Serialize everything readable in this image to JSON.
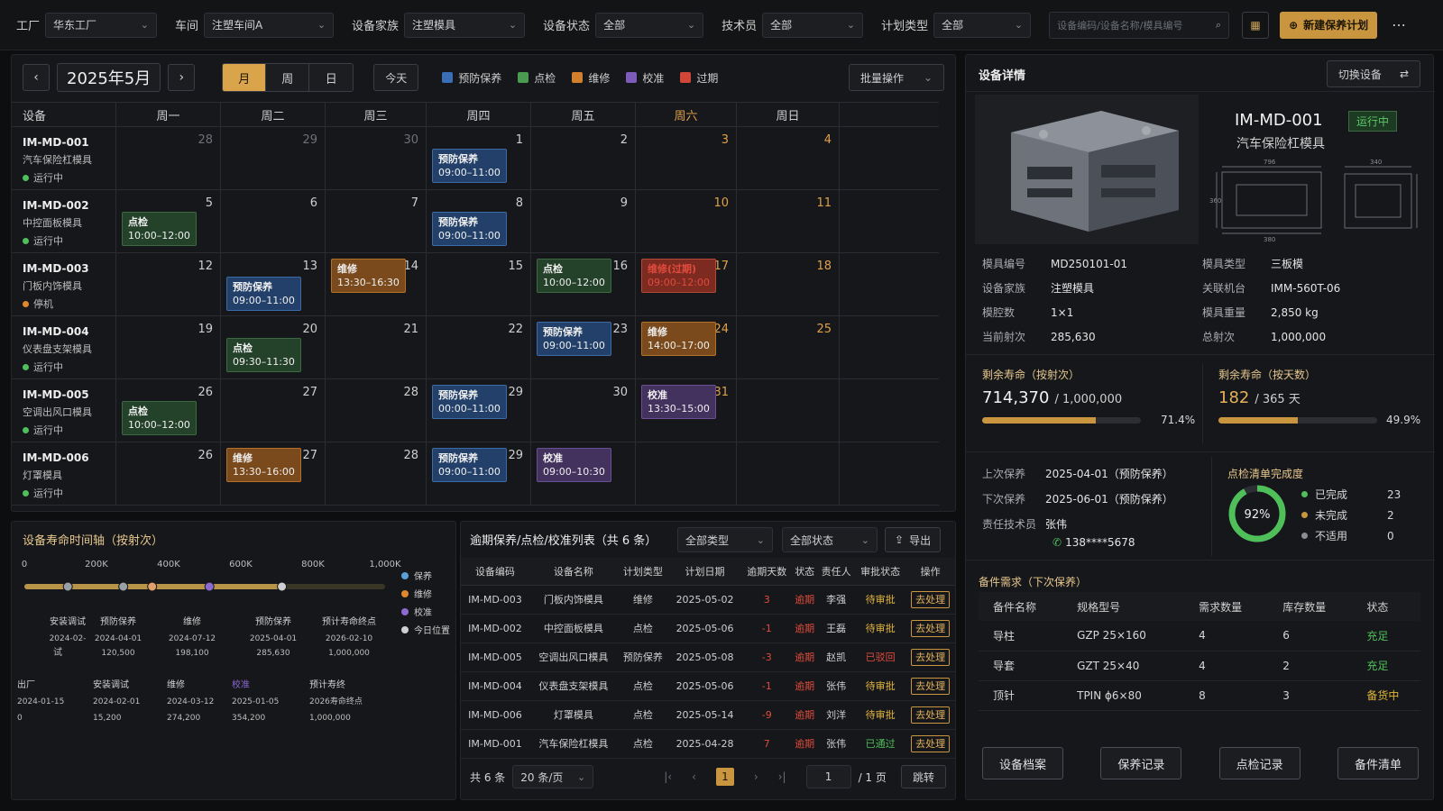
{
  "topbar": {
    "factory_label": "工厂",
    "factory_value": "华东工厂",
    "workshop_label": "车间",
    "workshop_value": "注塑车间A",
    "family_label": "设备家族",
    "family_value": "注塑模具",
    "status_label": "设备状态",
    "status_value": "全部",
    "tech_label": "技术员",
    "tech_value": "全部",
    "plan_label": "计划类型",
    "plan_value": "全部",
    "search_placeholder": "设备编码/设备名称/模具编号",
    "new_plan": "新建保养计划"
  },
  "calendar": {
    "title": "2025年5月",
    "views": [
      "月",
      "周",
      "日"
    ],
    "today": "今天",
    "batch": "批量操作",
    "legend": [
      {
        "label": "预防保养",
        "color": "#3a6fb5"
      },
      {
        "label": "点检",
        "color": "#4a9a4f"
      },
      {
        "label": "维修",
        "color": "#d27f2e"
      },
      {
        "label": "校准",
        "color": "#7c5cb8"
      },
      {
        "label": "过期",
        "color": "#d0473a"
      }
    ],
    "headers": [
      "设备",
      "周一",
      "周二",
      "周三",
      "周四",
      "周五",
      "周六",
      "周日"
    ],
    "rows": [
      {
        "code": "IM-MD-001",
        "name": "汽车保险杠模具",
        "status": "运行中",
        "status_color": "#4fbf5a",
        "days": [
          "28",
          "29",
          "30",
          "1",
          "2",
          "3",
          "4"
        ],
        "events": [
          {
            "col": 3,
            "type": "blue",
            "title": "预防保养",
            "time": "09:00–11:00"
          }
        ]
      },
      {
        "code": "IM-MD-002",
        "name": "中控面板模具",
        "status": "运行中",
        "status_color": "#4fbf5a",
        "days": [
          "5",
          "6",
          "7",
          "8",
          "9",
          "10",
          "11"
        ],
        "events": [
          {
            "col": 0,
            "type": "green",
            "title": "点检",
            "time": "10:00–12:00"
          },
          {
            "col": 3,
            "type": "blue",
            "title": "预防保养",
            "time": "09:00–11:00"
          }
        ]
      },
      {
        "code": "IM-MD-003",
        "name": "门板内饰模具",
        "status": "停机",
        "status_color": "#e0882e",
        "days": [
          "12",
          "13",
          "14",
          "15",
          "16",
          "17",
          "18"
        ],
        "events": [
          {
            "col": 1,
            "type": "blue",
            "title": "预防保养",
            "time": "09:00–11:00"
          },
          {
            "col": 2,
            "type": "orange",
            "title": "维修",
            "time": "13:30–16:30"
          },
          {
            "col": 4,
            "type": "green",
            "title": "点检",
            "time": "10:00–12:00"
          },
          {
            "col": 5,
            "type": "red",
            "title": "维修(过期)",
            "time": "09:00–12:00"
          }
        ]
      },
      {
        "code": "IM-MD-004",
        "name": "仪表盘支架模具",
        "status": "运行中",
        "status_color": "#4fbf5a",
        "days": [
          "19",
          "20",
          "21",
          "22",
          "23",
          "24",
          "25"
        ],
        "events": [
          {
            "col": 1,
            "type": "green",
            "title": "点检",
            "time": "09:30–11:30"
          },
          {
            "col": 4,
            "type": "blue",
            "title": "预防保养",
            "time": "09:00–11:00"
          },
          {
            "col": 5,
            "type": "orange",
            "title": "维修",
            "time": "14:00–17:00"
          }
        ]
      },
      {
        "code": "IM-MD-005",
        "name": "空调出风口模具",
        "status": "运行中",
        "status_color": "#4fbf5a",
        "days": [
          "26",
          "27",
          "28",
          "29",
          "30",
          "31",
          ""
        ],
        "events": [
          {
            "col": 0,
            "type": "green",
            "title": "点检",
            "time": "10:00–12:00"
          },
          {
            "col": 3,
            "type": "blue",
            "title": "预防保养",
            "time": "00:00–11:00"
          },
          {
            "col": 5,
            "type": "purple",
            "title": "校准",
            "time": "13:30–15:00"
          }
        ]
      },
      {
        "code": "IM-MD-006",
        "name": "灯罩模具",
        "status": "运行中",
        "status_color": "#4fbf5a",
        "days": [
          "26",
          "27",
          "28",
          "29",
          "",
          "",
          ""
        ],
        "events": [
          {
            "col": 1,
            "type": "orange",
            "title": "维修",
            "time": "13:30–16:00"
          },
          {
            "col": 3,
            "type": "blue",
            "title": "预防保养",
            "time": "09:00–11:00"
          },
          {
            "col": 4,
            "type": "purple",
            "title": "校准",
            "time": "09:00–10:30"
          }
        ]
      }
    ]
  },
  "timeline": {
    "title": "设备寿命时间轴（按射次）",
    "ticks": [
      "0",
      "200K",
      "400K",
      "600K",
      "800K",
      "1,000K"
    ],
    "tick_values": [
      0,
      200000,
      400000,
      600000,
      800000,
      1000000
    ],
    "progress": 0.714,
    "legend": [
      {
        "label": "保养",
        "color": "#5aa0d8"
      },
      {
        "label": "维修",
        "color": "#e0882e"
      },
      {
        "label": "校准",
        "color": "#8d6ad1"
      },
      {
        "label": "今日位置",
        "color": "#cfcfcf"
      }
    ],
    "upper_events": [
      {
        "label": "安装调试",
        "date": "2024-02-",
        "value": "",
        "extra": "试",
        "shot": 15200
      },
      {
        "label": "预防保养",
        "date": "2024-04-01",
        "value": "120,500",
        "shot": 120500
      },
      {
        "label": "维修",
        "date": "2024-07-12",
        "value": "198,100",
        "shot": 198100
      },
      {
        "label": "预防保养",
        "date": "2025-04-01",
        "value": "285,630",
        "shot": 285630
      },
      {
        "label": "预计寿命终点",
        "date": "2026-02-10",
        "value": "1,000,000",
        "shot": 1000000
      }
    ],
    "marker_shots": [
      120500,
      274200,
      354200,
      513000,
      714000
    ],
    "lower_events": [
      {
        "label": "出厂",
        "date": "2024-01-15",
        "value": "0"
      },
      {
        "label": "安装调试",
        "date": "2024-02-01",
        "value": "15,200"
      },
      {
        "label": "维修",
        "date": "2024-03-12",
        "value": "274,200"
      },
      {
        "label": "校准",
        "date": "2025-01-05",
        "value": "354,200"
      },
      {
        "label": "预计寿终",
        "date": "2026寿命终点",
        "value": "1,000,000"
      }
    ]
  },
  "overdue": {
    "title": "逾期保养/点检/校准列表（共 6 条）",
    "filter1": "全部类型",
    "filter2": "全部状态",
    "export": "导出",
    "columns": [
      "设备编码",
      "设备名称",
      "计划类型",
      "计划日期",
      "逾期天数",
      "状态",
      "责任人",
      "审批状态",
      "操作"
    ],
    "rows": [
      {
        "code": "IM-MD-003",
        "name": "门板内饰模具",
        "type": "维修",
        "date": "2025-05-02",
        "days": "3",
        "status": "逾期",
        "owner": "李强",
        "approval": "待审批",
        "approval_color": "yel",
        "action": "去处理"
      },
      {
        "code": "IM-MD-002",
        "name": "中控面板模具",
        "type": "点检",
        "date": "2025-05-06",
        "days": "-1",
        "status": "逾期",
        "owner": "王磊",
        "approval": "待审批",
        "approval_color": "yel",
        "action": "去处理"
      },
      {
        "code": "IM-MD-005",
        "name": "空调出风口模具",
        "type": "预防保养",
        "date": "2025-05-08",
        "days": "-3",
        "status": "逾期",
        "owner": "赵凯",
        "approval": "已驳回",
        "approval_color": "red",
        "action": "去处理"
      },
      {
        "code": "IM-MD-004",
        "name": "仪表盘支架模具",
        "type": "点检",
        "date": "2025-05-06",
        "days": "-1",
        "status": "逾期",
        "owner": "张伟",
        "approval": "待审批",
        "approval_color": "yel",
        "action": "去处理"
      },
      {
        "code": "IM-MD-006",
        "name": "灯罩模具",
        "type": "点检",
        "date": "2025-05-14",
        "days": "-9",
        "status": "逾期",
        "owner": "刘洋",
        "approval": "待审批",
        "approval_color": "yel",
        "action": "去处理"
      },
      {
        "code": "IM-MD-001",
        "name": "汽车保险杠模具",
        "type": "点检",
        "date": "2025-04-28",
        "days": "7",
        "status": "逾期",
        "owner": "张伟",
        "approval": "已通过",
        "approval_color": "grn",
        "action": "去处理"
      }
    ],
    "total": "共 6 条",
    "page_size": "20 条/页",
    "current_page": "1",
    "page_input": "1",
    "page_total": "/ 1 页",
    "jump": "跳转"
  },
  "detail": {
    "title": "设备详情",
    "switch": "切换设备",
    "code": "IM-MD-001",
    "status": "运行中",
    "name": "汽车保险杠模具",
    "drawing_dims": [
      "796",
      "340",
      "380",
      "360"
    ],
    "fields": [
      {
        "label": "模具编号",
        "value": "MD250101-01"
      },
      {
        "label": "模具类型",
        "value": "三板模"
      },
      {
        "label": "设备家族",
        "value": "注塑模具"
      },
      {
        "label": "关联机台",
        "value": "IMM-560T-06"
      },
      {
        "label": "模腔数",
        "value": "1×1"
      },
      {
        "label": "模具重量",
        "value": "2,850 kg"
      },
      {
        "label": "当前射次",
        "value": "285,630"
      },
      {
        "label": "总射次",
        "value": "1,000,000"
      }
    ],
    "life_shots_title": "剩余寿命（按射次）",
    "life_shots_value": "714,370",
    "life_shots_total": "/ 1,000,000",
    "life_shots_pct": "71.4%",
    "life_shots_ratio": 0.714,
    "life_days_title": "剩余寿命（按天数）",
    "life_days_value": "182",
    "life_days_total": "/ 365 天",
    "life_days_pct": "49.9%",
    "life_days_ratio": 0.499,
    "last_label": "上次保养",
    "last_value": "2025-04-01（预防保养）",
    "next_label": "下次保养",
    "next_value": "2025-06-01（预防保养）",
    "owner_label": "责任技术员",
    "owner_value": "张伟",
    "phone": "138****5678",
    "checklist_title": "点检清单完成度",
    "checklist_pct": "92%",
    "checklist_ratio": 0.92,
    "checklist_items": [
      {
        "label": "已完成",
        "value": "23",
        "color": "#4fbf5a"
      },
      {
        "label": "未完成",
        "value": "2",
        "color": "#c9963f"
      },
      {
        "label": "不适用",
        "value": "0",
        "color": "#8a8d94"
      }
    ],
    "parts_title": "备件需求（下次保养）",
    "parts_columns": [
      "备件名称",
      "规格型号",
      "需求数量",
      "库存数量",
      "状态"
    ],
    "parts": [
      {
        "name": "导柱",
        "spec": "GZP 25×160",
        "need": "4",
        "stock": "6",
        "status": "充足",
        "color": "grn"
      },
      {
        "name": "导套",
        "spec": "GZT 25×40",
        "need": "4",
        "stock": "2",
        "status": "充足",
        "color": "grn"
      },
      {
        "name": "顶针",
        "spec": "TPIN ϕ6×80",
        "need": "8",
        "stock": "3",
        "status": "备货中",
        "color": "yel"
      }
    ],
    "buttons": [
      "设备档案",
      "保养记录",
      "点检记录",
      "备件清单"
    ]
  }
}
